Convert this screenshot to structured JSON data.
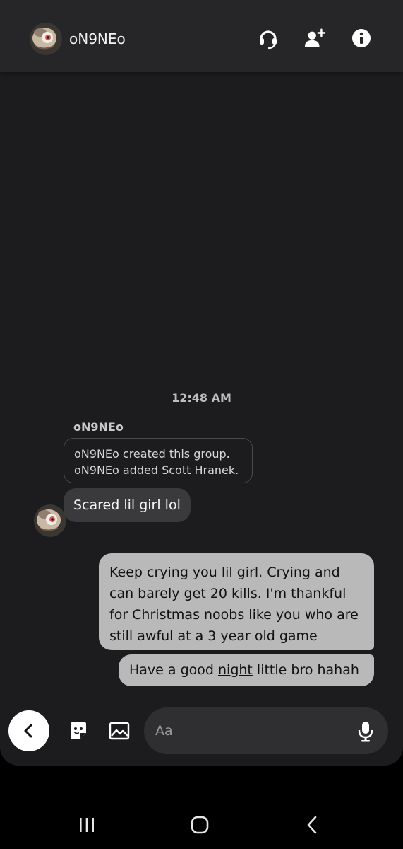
{
  "header": {
    "title": "oN9NEo",
    "icons": [
      "headset-icon",
      "add-friend-icon",
      "info-icon"
    ]
  },
  "messages": {
    "timestamp": "12:48 AM",
    "sender_name": "oN9NEo",
    "system_lines": [
      "oN9NEo created this group.",
      "oN9NEo added Scott Hranek."
    ],
    "incoming": "Scared lil girl lol",
    "outgoing_1_lines": [
      "Keep crying you lil girl. Crying and",
      "can barely get 20 kills. I'm thankful",
      "for Christmas noobs like you who are",
      "still awful at a 3 year old game"
    ],
    "outgoing_2": {
      "before": "Have a good ",
      "underlined": "night",
      "after": " little bro hahah"
    }
  },
  "composer": {
    "placeholder": "Aa",
    "icons": [
      "back-icon",
      "sticker-icon",
      "image-icon",
      "microphone-icon"
    ]
  },
  "navbar": {
    "icons": [
      "recent-apps-icon",
      "home-icon",
      "nav-back-icon"
    ]
  },
  "colors": {
    "chat_bg": "#1c1c1e",
    "header_bg": "#262628",
    "incoming_bubble": "#3a3a3c",
    "outgoing_bubble": "#b9b9b9",
    "input_bg": "#2f2f31"
  }
}
